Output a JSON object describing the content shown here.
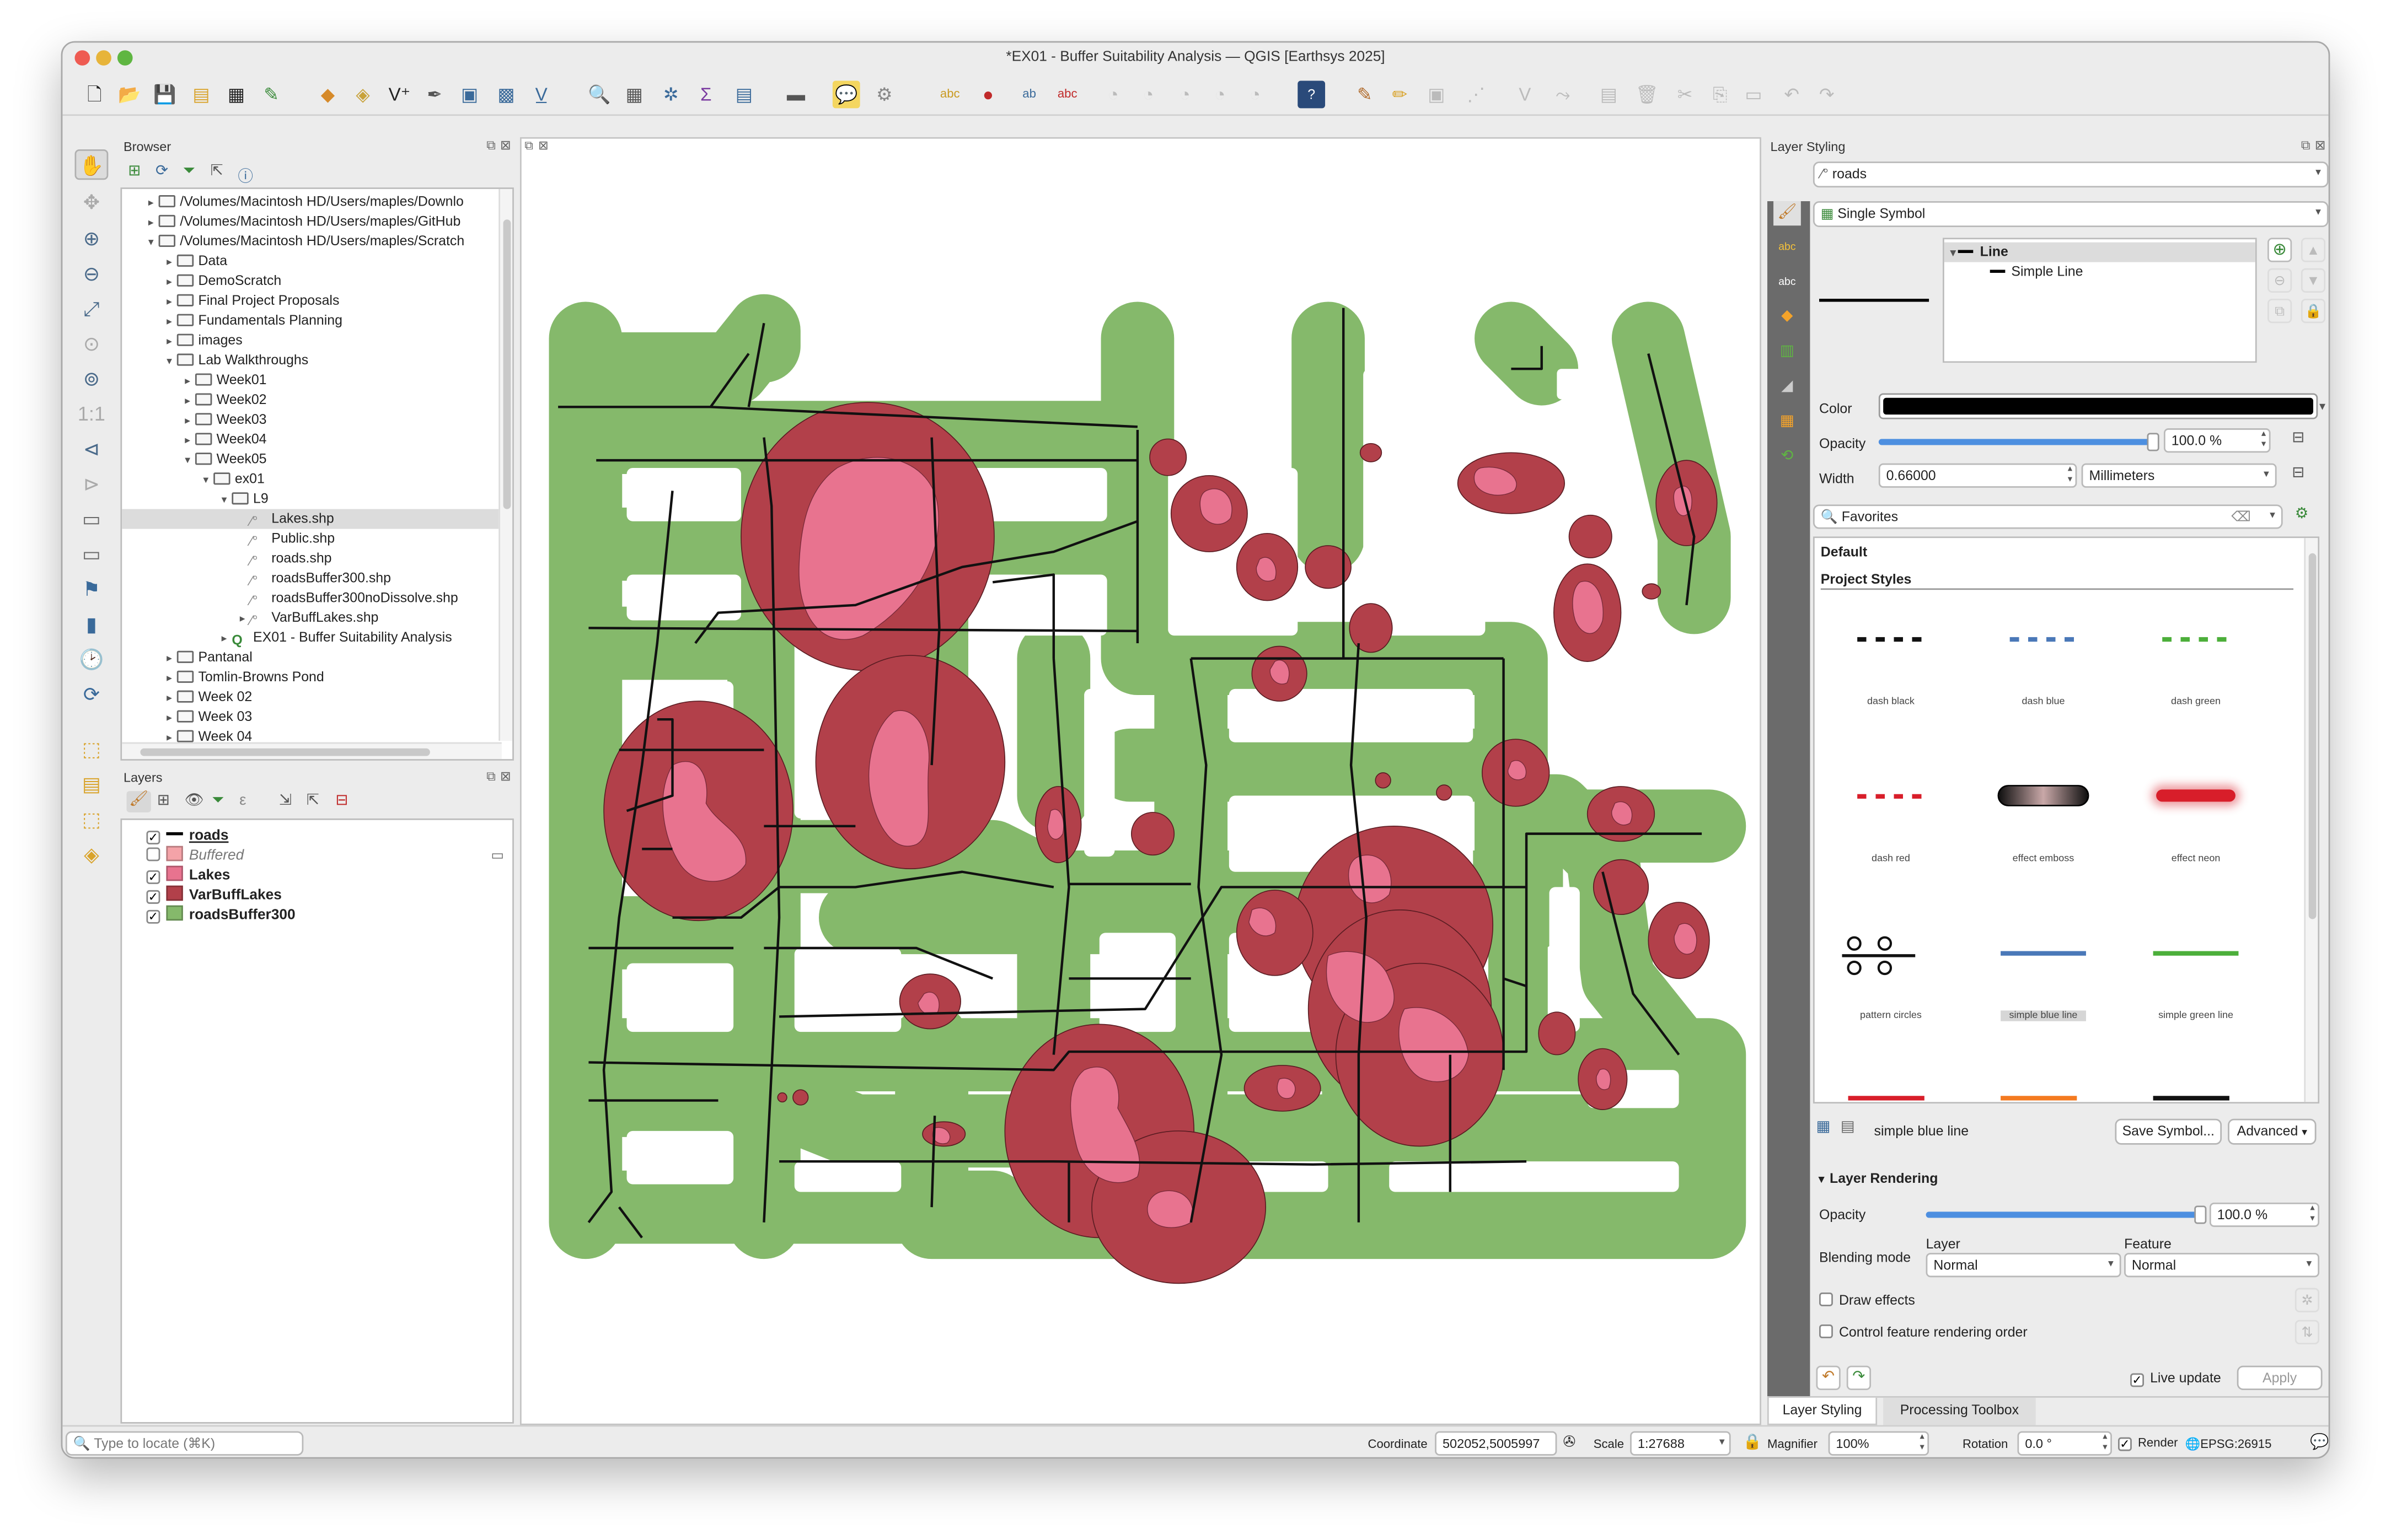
{
  "window": {
    "title": "*EX01 - Buffer Suitability Analysis — QGIS [Earthsys 2025]"
  },
  "browser": {
    "title": "Browser",
    "items": [
      {
        "label": "/Volumes/Macintosh HD/Users/maples/Downlo",
        "kind": "folder",
        "arrow": "▸"
      },
      {
        "label": "/Volumes/Macintosh HD/Users/maples/GitHub",
        "kind": "folder",
        "arrow": "▸"
      },
      {
        "label": "/Volumes/Macintosh HD/Users/maples/Scratch",
        "kind": "folder",
        "arrow": "▾"
      },
      {
        "label": "Data",
        "kind": "folder",
        "arrow": "▸"
      },
      {
        "label": "DemoScratch",
        "kind": "folder",
        "arrow": "▸"
      },
      {
        "label": "Final Project Proposals",
        "kind": "folder",
        "arrow": "▸"
      },
      {
        "label": "Fundamentals Planning",
        "kind": "folder",
        "arrow": "▸"
      },
      {
        "label": "images",
        "kind": "folder",
        "arrow": "▸"
      },
      {
        "label": "Lab Walkthroughs",
        "kind": "folder",
        "arrow": "▾"
      },
      {
        "label": "Week01",
        "kind": "folder",
        "arrow": "▸"
      },
      {
        "label": "Week02",
        "kind": "folder",
        "arrow": "▸"
      },
      {
        "label": "Week03",
        "kind": "folder",
        "arrow": "▸"
      },
      {
        "label": "Week04",
        "kind": "folder",
        "arrow": "▸"
      },
      {
        "label": "Week05",
        "kind": "folder",
        "arrow": "▾"
      },
      {
        "label": "ex01",
        "kind": "folder",
        "arrow": "▾"
      },
      {
        "label": "L9",
        "kind": "folder",
        "arrow": "▾"
      },
      {
        "label": "Lakes.shp",
        "kind": "file",
        "arrow": ""
      },
      {
        "label": "Public.shp",
        "kind": "file",
        "arrow": ""
      },
      {
        "label": "roads.shp",
        "kind": "file",
        "arrow": ""
      },
      {
        "label": "roadsBuffer300.shp",
        "kind": "file",
        "arrow": ""
      },
      {
        "label": "roadsBuffer300noDissolve.shp",
        "kind": "file",
        "arrow": ""
      },
      {
        "label": "VarBuffLakes.shp",
        "kind": "file",
        "arrow": "▸"
      },
      {
        "label": "EX01 - Buffer Suitability Analysis",
        "kind": "project",
        "arrow": "▸"
      },
      {
        "label": "Pantanal",
        "kind": "folder",
        "arrow": "▸"
      },
      {
        "label": "Tomlin-Browns Pond",
        "kind": "folder",
        "arrow": "▸"
      },
      {
        "label": "Week 02",
        "kind": "folder",
        "arrow": "▸"
      },
      {
        "label": "Week 03",
        "kind": "folder",
        "arrow": "▸"
      },
      {
        "label": "Week 04",
        "kind": "folder",
        "arrow": "▸"
      }
    ]
  },
  "layers": {
    "title": "Layers",
    "items": [
      {
        "label": "roads",
        "checked": true,
        "swatch": "line",
        "color": "#000000",
        "style": "bold-underline"
      },
      {
        "label": "Buffered",
        "checked": false,
        "swatch": "fill",
        "color": "#f4a3a8",
        "style": "italic"
      },
      {
        "label": "Lakes",
        "checked": true,
        "swatch": "fill",
        "color": "#e8738f",
        "style": "bold"
      },
      {
        "label": "VarBuffLakes",
        "checked": true,
        "swatch": "fill",
        "color": "#b2404a",
        "style": "bold"
      },
      {
        "label": "roadsBuffer300",
        "checked": true,
        "swatch": "fill",
        "color": "#85b96b",
        "style": "bold"
      }
    ]
  },
  "styling": {
    "title": "Layer Styling",
    "layer": "roads",
    "renderer": "Single Symbol",
    "tree": [
      "Line",
      "Simple Line"
    ],
    "color_label": "Color",
    "color": "#000000",
    "opacity_label": "Opacity",
    "opacity": "100.0 %",
    "width_label": "Width",
    "width": "0.66000",
    "units": "Millimeters",
    "search": "Favorites",
    "section_default": "Default",
    "section_project": "Project Styles",
    "symbols": [
      {
        "name": "dash  black",
        "kind": "dash",
        "color": "#111111"
      },
      {
        "name": "dash blue",
        "kind": "dash",
        "color": "#4a78b8"
      },
      {
        "name": "dash green",
        "kind": "dash",
        "color": "#4caf3a"
      },
      {
        "name": "dash red",
        "kind": "dash",
        "color": "#d81e2a"
      },
      {
        "name": "effect emboss",
        "kind": "emboss",
        "color": "#1a1a1a"
      },
      {
        "name": "effect neon",
        "kind": "neon",
        "color": "#d81e2a"
      },
      {
        "name": "pattern circles",
        "kind": "circles",
        "color": "#111111"
      },
      {
        "name": "simple blue line",
        "kind": "line",
        "color": "#4a78b8"
      },
      {
        "name": "simple green line",
        "kind": "line",
        "color": "#4caf3a"
      }
    ],
    "selected_symbol": "simple blue line",
    "save_symbol": "Save Symbol...",
    "advanced": "Advanced",
    "layer_rendering": "Layer Rendering",
    "lr_opacity_label": "Opacity",
    "lr_opacity": "100.0 %",
    "blending_label": "Blending mode",
    "layer_col": "Layer",
    "feature_col": "Feature",
    "layer_blend": "Normal",
    "feature_blend": "Normal",
    "draw_effects": "Draw effects",
    "control_order": "Control feature rendering order",
    "live_update": "Live update",
    "apply": "Apply",
    "tabs": [
      "Layer Styling",
      "Processing Toolbox"
    ]
  },
  "status": {
    "locate_placeholder": "Type to locate (⌘K)",
    "coordinate_label": "Coordinate",
    "coordinate": "502052,5005997",
    "scale_label": "Scale",
    "scale": "1:27688",
    "magnifier_label": "Magnifier",
    "magnifier": "100%",
    "rotation_label": "Rotation",
    "rotation": "0.0 °",
    "render_label": "Render",
    "crs": "EPSG:26915"
  }
}
